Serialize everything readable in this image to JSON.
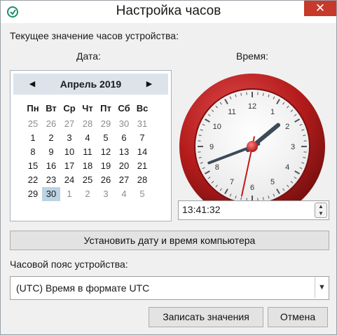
{
  "window": {
    "title": "Настройка часов",
    "close_label": "✕"
  },
  "labels": {
    "current": "Текущее значение часов устройства:",
    "date": "Дата:",
    "time": "Время:",
    "timezone": "Часовой пояс устройства:"
  },
  "calendar": {
    "month": "Апрель 2019",
    "prev_icon": "◀",
    "next_icon": "▶",
    "weekdays": [
      "Пн",
      "Вт",
      "Ср",
      "Чт",
      "Пт",
      "Сб",
      "Вс"
    ],
    "days": [
      "25",
      "26",
      "27",
      "28",
      "29",
      "30",
      "31",
      "1",
      "2",
      "3",
      "4",
      "5",
      "6",
      "7",
      "8",
      "9",
      "10",
      "11",
      "12",
      "13",
      "14",
      "15",
      "16",
      "17",
      "18",
      "19",
      "20",
      "21",
      "22",
      "23",
      "24",
      "25",
      "26",
      "27",
      "28",
      "29",
      "30",
      "1",
      "2",
      "3",
      "4",
      "5"
    ],
    "other_month": [
      true,
      true,
      true,
      true,
      true,
      true,
      true,
      false,
      false,
      false,
      false,
      false,
      false,
      false,
      false,
      false,
      false,
      false,
      false,
      false,
      false,
      false,
      false,
      false,
      false,
      false,
      false,
      false,
      false,
      false,
      false,
      false,
      false,
      false,
      false,
      false,
      false,
      true,
      true,
      true,
      true,
      true
    ],
    "selected_index": 36
  },
  "clock": {
    "hour": 13,
    "minute": 41,
    "second": 32,
    "rim_color": "#b31b1b",
    "hand_color": "#3d4a57",
    "second_hand_color": "#c01818"
  },
  "time": {
    "value": "13:41:32",
    "spin_up": "▲",
    "spin_down": "▼"
  },
  "buttons": {
    "sync": "Установить дату и время компьютера",
    "save": "Записать значения",
    "cancel": "Отмена"
  },
  "timezone": {
    "value": "(UTC) Время в формате UTC",
    "arrow": "▼"
  }
}
